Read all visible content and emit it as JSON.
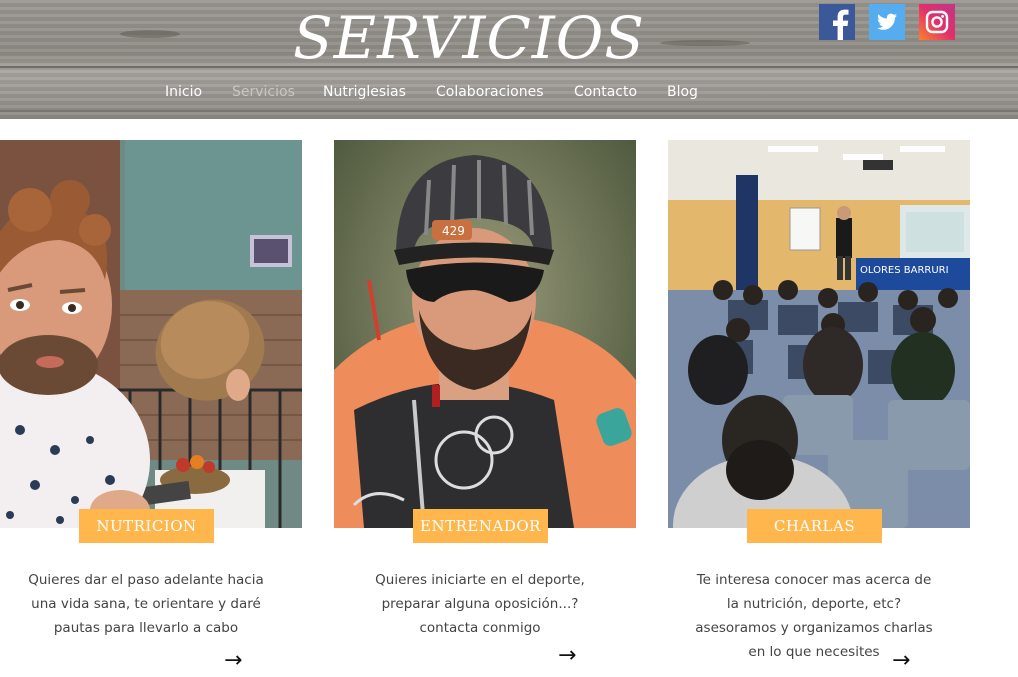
{
  "header": {
    "title": "SERVICIOS",
    "social": [
      {
        "name": "facebook",
        "glyph": "f",
        "color": "#3b5998"
      },
      {
        "name": "twitter",
        "glyph": "twitter-bird",
        "color": "#55acee"
      },
      {
        "name": "instagram",
        "glyph": "instagram-camera",
        "color": "#e1306c"
      }
    ]
  },
  "nav": {
    "items": [
      "Inicio",
      "Servicios",
      "Nutriglesias",
      "Colaboraciones",
      "Contacto",
      "Blog"
    ],
    "active": "Servicios"
  },
  "cards": [
    {
      "label": "NUTRICION",
      "image": "man holding bread photo",
      "description": "Quieres dar el paso adelante hacia una vida sana, te orientare y daré pautas para llevarlo a cabo",
      "arrow": "→"
    },
    {
      "label": "ENTRENADOR",
      "image": "cyclist with helmet photo",
      "description": "Quieres iniciarte en el deporte, preparar alguna oposición...? contacta conmigo",
      "arrow": "→"
    },
    {
      "label": "CHARLAS",
      "image": "talk in classroom photo",
      "description": "Te interesa conocer mas acerca de la nutrición, deporte, etc? asesoramos y organizamos charlas en lo que necesites",
      "arrow": "→"
    }
  ],
  "colors": {
    "ribbon": "#ffb74d",
    "nav_active": "#c9c6c1"
  }
}
